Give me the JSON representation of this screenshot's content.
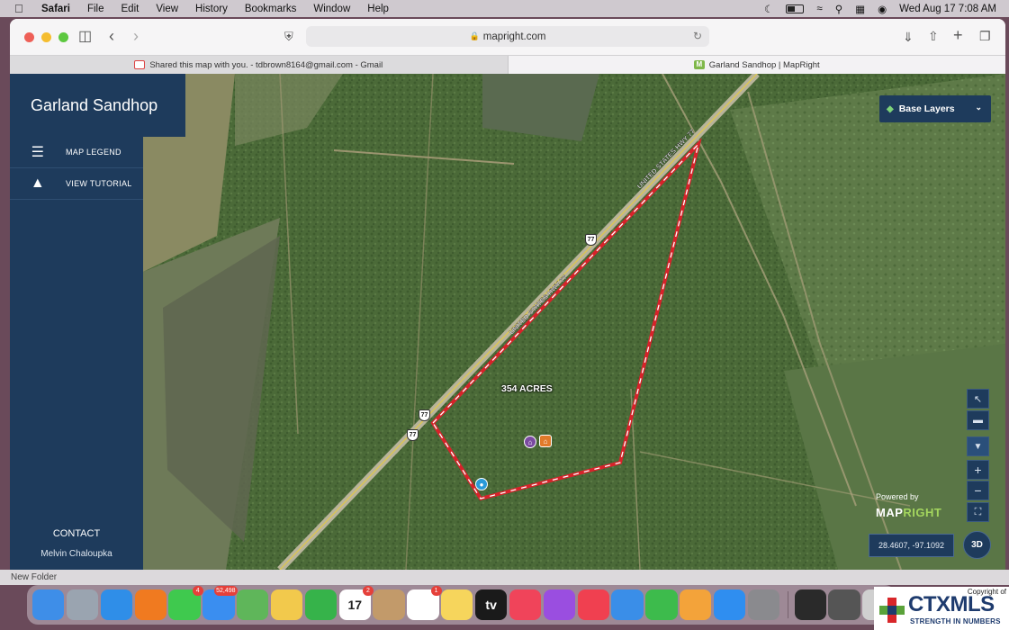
{
  "menubar": {
    "app": "Safari",
    "items": [
      "File",
      "Edit",
      "View",
      "History",
      "Bookmarks",
      "Window",
      "Help"
    ],
    "datetime": "Wed Aug 17  7:08 AM"
  },
  "browser": {
    "url": "mapright.com",
    "tabs": [
      {
        "title": "Shared this map with you. - tdbrown8164@gmail.com - Gmail"
      },
      {
        "title": "Garland Sandhop | MapRight"
      }
    ]
  },
  "sidebar": {
    "title": "Garland Sandhop",
    "items": [
      {
        "label": "MAP LEGEND",
        "icon": "layers-icon"
      },
      {
        "label": "VIEW TUTORIAL",
        "icon": "graduation-cap-icon"
      }
    ],
    "contact_label": "CONTACT",
    "agent_name": "Melvin Chaloupka"
  },
  "map": {
    "base_layers_label": "Base Layers",
    "acreage_label": "354 ACRES",
    "highway_label": "UNITED STATES HWY 77",
    "route_shield": "77",
    "coordinates": "28.4607, -97.1092",
    "btn_3d": "3D",
    "powered_by": "Powered by",
    "logo_a": "MAP",
    "logo_b": "RIGHT",
    "boundary_color": "#d8222a"
  },
  "below_window": {
    "folder": "New Folder"
  },
  "dock": {
    "apps": [
      {
        "name": "finder",
        "color": "#3e8ee8"
      },
      {
        "name": "launchpad",
        "color": "#9aa4b0"
      },
      {
        "name": "safari",
        "color": "#2f8ee8"
      },
      {
        "name": "firefox",
        "color": "#f07a20"
      },
      {
        "name": "messages",
        "color": "#3fc94e",
        "badge": "4"
      },
      {
        "name": "mail",
        "color": "#3a8ef0",
        "badge": "52,498"
      },
      {
        "name": "maps",
        "color": "#5fb65a"
      },
      {
        "name": "photos",
        "color": "#f2c94c"
      },
      {
        "name": "facetime",
        "color": "#36b34a"
      },
      {
        "name": "calendar",
        "color": "#ffffff",
        "badge": "2",
        "text": "17"
      },
      {
        "name": "contacts",
        "color": "#c29a6a"
      },
      {
        "name": "reminders",
        "color": "#ffffff",
        "badge": "1"
      },
      {
        "name": "notes",
        "color": "#f6d55c"
      },
      {
        "name": "apple-tv",
        "color": "#1a1a1a",
        "text": "tv"
      },
      {
        "name": "music",
        "color": "#f0445a"
      },
      {
        "name": "podcasts",
        "color": "#9a4ee0"
      },
      {
        "name": "news",
        "color": "#f04050"
      },
      {
        "name": "keynote",
        "color": "#3a8ee8"
      },
      {
        "name": "numbers",
        "color": "#3dbb4c"
      },
      {
        "name": "pages",
        "color": "#f3a33a"
      },
      {
        "name": "app-store",
        "color": "#2f8ef0"
      },
      {
        "name": "system-preferences",
        "color": "#8a8a8e"
      },
      {
        "name": "terminal",
        "color": "#2a2a2a"
      },
      {
        "name": "preview",
        "color": "#555555"
      },
      {
        "name": "trash",
        "color": "#d0d0d0"
      }
    ]
  },
  "watermark": {
    "copyright": "Copyright of",
    "name": "CTXMLS",
    "tagline": "STRENGTH IN NUMBERS"
  }
}
